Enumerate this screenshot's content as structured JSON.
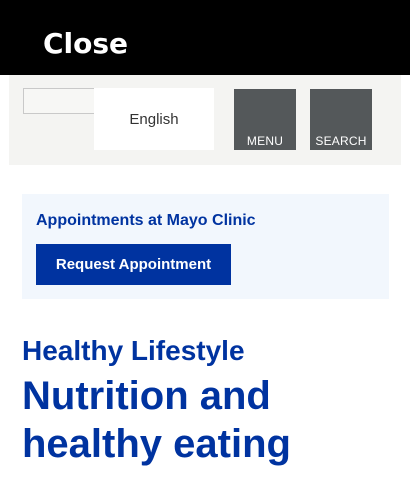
{
  "overlay": {
    "close_label": "Close"
  },
  "header": {
    "language": "English",
    "menu_label": "MENU",
    "search_label": "SEARCH"
  },
  "appointments": {
    "title": "Appointments at Mayo Clinic",
    "button_label": "Request Appointment"
  },
  "article": {
    "kicker": "Healthy Lifestyle",
    "title": "Nutrition and healthy eating"
  },
  "colors": {
    "brand_blue": "#0033a0",
    "nav_gray": "#54585a",
    "panel_bg": "#f2f7fd"
  }
}
